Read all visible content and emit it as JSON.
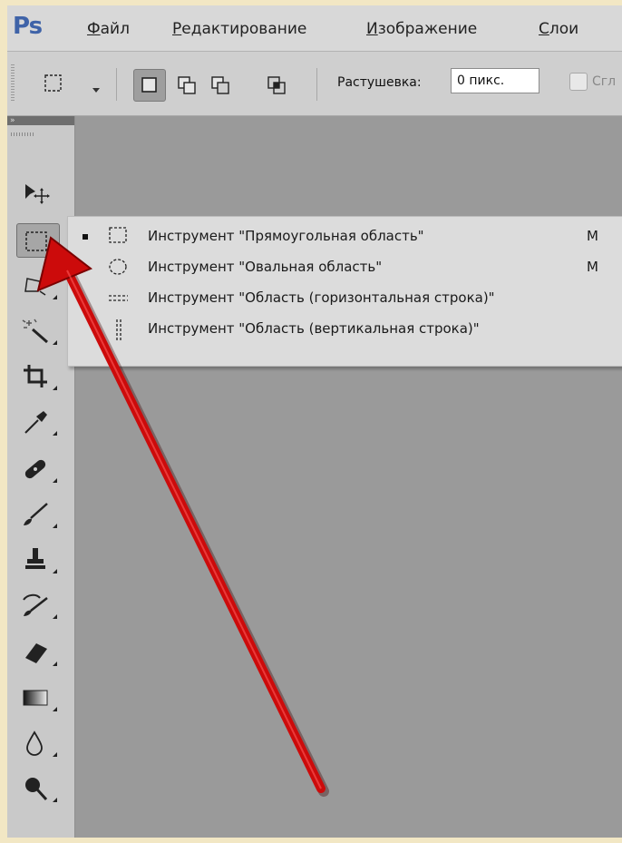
{
  "app": {
    "logo": "Ps"
  },
  "menu": {
    "items": [
      {
        "first": "Ф",
        "rest": "айл"
      },
      {
        "first": "Р",
        "rest": "едактирование"
      },
      {
        "first": "И",
        "rest": "зображение"
      },
      {
        "first": "С",
        "rest": "лои"
      }
    ]
  },
  "options": {
    "feather_label": "Растушевка:",
    "feather_value": "0 пикс.",
    "antialias_cut_label": "Сгл"
  },
  "toolbar": {
    "collapse_glyph": "»",
    "tools": [
      "move-tool",
      "rectangular-marquee-tool",
      "lasso-tool",
      "magic-wand-tool",
      "crop-tool",
      "eyedropper-tool",
      "healing-brush-tool",
      "brush-tool",
      "clone-stamp-tool",
      "history-brush-tool",
      "eraser-tool",
      "gradient-tool",
      "blur-tool",
      "dodge-tool"
    ]
  },
  "flyout": {
    "items": [
      {
        "label": "Инструмент \"Прямоугольная область\"",
        "key": "M",
        "selected": true
      },
      {
        "label": "Инструмент \"Овальная область\"",
        "key": "M",
        "selected": false
      },
      {
        "label": "Инструмент \"Область (горизонтальная строка)\"",
        "key": "",
        "selected": false
      },
      {
        "label": "Инструмент \"Область (вертикальная строка)\"",
        "key": "",
        "selected": false
      }
    ]
  },
  "colors": {
    "arrow": "#cc0b0b",
    "ps_blue": "#3f63a8",
    "canvas": "#9a9a9a"
  }
}
